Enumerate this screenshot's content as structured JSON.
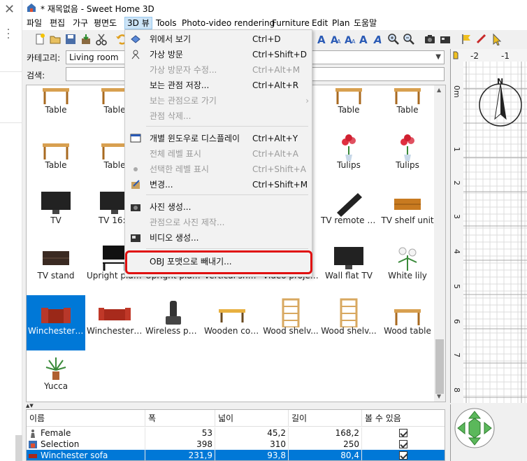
{
  "window": {
    "title": "* 재목없음 - Sweet Home 3D"
  },
  "menubar": [
    "파일",
    "편집",
    "가구",
    "평면도",
    "3D 뷰",
    "Tools",
    "Photo-video rendering",
    "Furniture",
    "Edit",
    "Plan",
    "도움말"
  ],
  "category": {
    "label": "카테고리:",
    "value": "Living room"
  },
  "search": {
    "label": "검색:",
    "value": ""
  },
  "catalog": [
    {
      "label": "Table",
      "icon": "table-icon"
    },
    {
      "label": "Table",
      "icon": "table-icon"
    },
    {
      "label": "",
      "icon": ""
    },
    {
      "label": "",
      "icon": ""
    },
    {
      "label": "",
      "icon": ""
    },
    {
      "label": "Table",
      "icon": "table-icon"
    },
    {
      "label": "Table",
      "icon": "table-icon"
    },
    {
      "label": "Table",
      "icon": "table-icon"
    },
    {
      "label": "Table",
      "icon": "table-icon"
    },
    {
      "label": "",
      "icon": ""
    },
    {
      "label": "",
      "icon": ""
    },
    {
      "label": "",
      "icon": ""
    },
    {
      "label": "Tulips",
      "icon": "tulips-icon"
    },
    {
      "label": "Tulips",
      "icon": "tulips-icon"
    },
    {
      "label": "TV",
      "icon": "tv-icon"
    },
    {
      "label": "TV 16:9",
      "icon": "tv-icon"
    },
    {
      "label": "",
      "icon": ""
    },
    {
      "label": "",
      "icon": ""
    },
    {
      "label": "",
      "icon": ""
    },
    {
      "label": "TV remote c...",
      "icon": "remote-icon"
    },
    {
      "label": "TV shelf unit",
      "icon": "shelf-icon"
    },
    {
      "label": "TV stand",
      "icon": "tvstand-icon"
    },
    {
      "label": "Upright pian...",
      "icon": "piano-icon"
    },
    {
      "label": "Upright pian...",
      "icon": "piano-icon"
    },
    {
      "label": "Vertical shel...",
      "icon": "shelf-icon"
    },
    {
      "label": "Video projec...",
      "icon": "projector-icon"
    },
    {
      "label": "Wall flat TV",
      "icon": "tv-icon"
    },
    {
      "label": "White lily",
      "icon": "lily-icon"
    },
    {
      "label": "Winchester ...",
      "icon": "armchair-icon"
    },
    {
      "label": "Winchester s...",
      "icon": "sofa-icon"
    },
    {
      "label": "Wireless pho...",
      "icon": "phone-icon"
    },
    {
      "label": "Wooden cof...",
      "icon": "coffeetable-icon"
    },
    {
      "label": "Wood shelv...",
      "icon": "bookshelf-icon"
    },
    {
      "label": "Wood shelv...",
      "icon": "bookshelf-icon"
    },
    {
      "label": "Wood table",
      "icon": "table-icon"
    },
    {
      "label": "Yucca",
      "icon": "plant-icon"
    }
  ],
  "menu": {
    "items": [
      {
        "label": "위에서 보기",
        "shortcut": "Ctrl+D",
        "enabled": true,
        "icon": "aerial-view-icon"
      },
      {
        "label": "가상 방문",
        "shortcut": "Ctrl+Shift+D",
        "enabled": true,
        "icon": "virtual-visit-icon"
      },
      {
        "label": "가상 방문자 수정...",
        "shortcut": "Ctrl+Alt+M",
        "enabled": false,
        "icon": ""
      },
      {
        "label": "보는 관점 저장...",
        "shortcut": "Ctrl+Alt+R",
        "enabled": true,
        "icon": ""
      },
      {
        "label": "보는 관점으로 가기",
        "shortcut": "",
        "enabled": false,
        "icon": ""
      },
      {
        "label": "관점 삭제...",
        "shortcut": "",
        "enabled": false,
        "icon": ""
      },
      {
        "label": "개별 윈도우로 디스플레이",
        "shortcut": "Ctrl+Alt+Y",
        "enabled": true,
        "icon": "window-icon"
      },
      {
        "label": "전체 레벨 표시",
        "shortcut": "Ctrl+Alt+A",
        "enabled": false,
        "icon": ""
      },
      {
        "label": "선택한 레벨 표시",
        "shortcut": "Ctrl+Shift+A",
        "enabled": false,
        "icon": "bullet-icon"
      },
      {
        "label": "변경...",
        "shortcut": "Ctrl+Shift+M",
        "enabled": true,
        "icon": "modify-icon"
      },
      {
        "label": "사진 생성...",
        "shortcut": "",
        "enabled": true,
        "icon": "camera-icon"
      },
      {
        "label": "관점으로 사진 제작...",
        "shortcut": "",
        "enabled": false,
        "icon": ""
      },
      {
        "label": "비디오 생성...",
        "shortcut": "",
        "enabled": true,
        "icon": "video-icon"
      },
      {
        "label": "OBJ 포맷으로 빼내기...",
        "shortcut": "",
        "enabled": true,
        "icon": ""
      }
    ]
  },
  "furniture_table": {
    "headers": [
      "이름",
      "폭",
      "넓이",
      "길이",
      "볼 수 있음"
    ],
    "rows": [
      {
        "name": "Female",
        "w": "53",
        "d": "45,2",
        "h": "168,2",
        "visible": true,
        "selected": false
      },
      {
        "name": "Selection",
        "w": "398",
        "d": "310",
        "h": "250",
        "visible": true,
        "selected": false
      },
      {
        "name": "Winchester sofa",
        "w": "231,9",
        "d": "93,8",
        "h": "80,4",
        "visible": true,
        "selected": true
      }
    ]
  },
  "plan": {
    "ruler_x": [
      "-2",
      "-1"
    ],
    "ruler_y": [
      "0m",
      "1",
      "2",
      "3",
      "4",
      "5",
      "6",
      "7",
      "8"
    ],
    "compass": "N"
  },
  "colors": {
    "selection": "#0078d7",
    "highlight_box": "#e01010",
    "accent": "#4caf50"
  }
}
